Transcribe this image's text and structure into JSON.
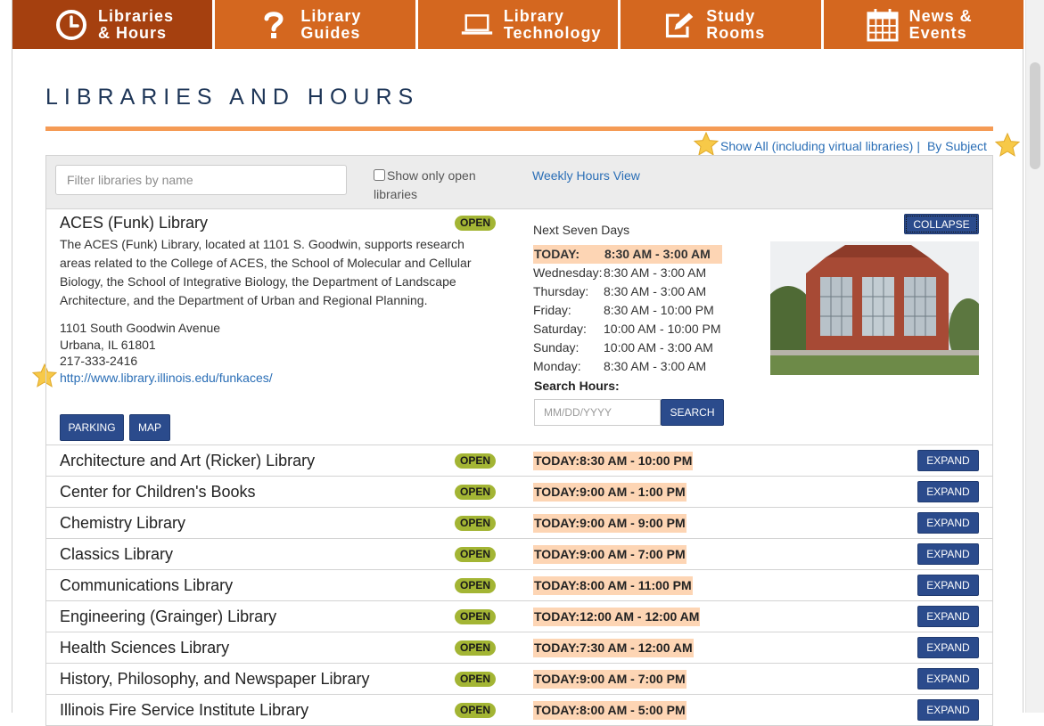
{
  "nav": {
    "tabs": [
      {
        "label": "Libraries\n& Hours",
        "icon": "clock-icon",
        "active": true
      },
      {
        "label": "Library\nGuides",
        "icon": "question-mark-icon",
        "active": false
      },
      {
        "label": "Library\nTechnology",
        "icon": "laptop-icon",
        "active": false
      },
      {
        "label": "Study\nRooms",
        "icon": "pencil-square-icon",
        "active": false
      },
      {
        "label": "News &\nEvents",
        "icon": "calendar-icon",
        "active": false
      }
    ]
  },
  "page": {
    "title": "LIBRARIES AND HOURS"
  },
  "links": {
    "show_all": "Show All (including virtual libraries)",
    "separator": "|",
    "by_subject": "By Subject"
  },
  "filter": {
    "placeholder": "Filter libraries by name",
    "open_only_label": "Show only open libraries",
    "weekly_link": "Weekly Hours View"
  },
  "expanded": {
    "name": "ACES (Funk) Library",
    "status": "OPEN",
    "collapse_label": "COLLAPSE",
    "description": "The ACES (Funk) Library, located at 1101 S. Goodwin, supports research areas related to the College of ACES, the School of Molecular and Cellular Biology, the School of Integrative Biology, the Department of Landscape Architecture, and the Department of Urban and Regional Planning.",
    "address1": "1101 South Goodwin Avenue",
    "address2": "Urbana, IL 61801",
    "phone": "217-333-2416",
    "url": "http://www.library.illinois.edu/funkaces/",
    "parking_label": "PARKING",
    "map_label": "MAP",
    "week_title": "Next Seven Days",
    "hours": [
      {
        "day": "TODAY:",
        "time": "8:30 AM - 3:00 AM"
      },
      {
        "day": "Wednesday:",
        "time": "8:30 AM - 3:00 AM"
      },
      {
        "day": "Thursday:",
        "time": "8:30 AM - 3:00 AM"
      },
      {
        "day": "Friday:",
        "time": "8:30 AM - 10:00 PM"
      },
      {
        "day": "Saturday:",
        "time": "10:00 AM - 10:00 PM"
      },
      {
        "day": "Sunday:",
        "time": "10:00 AM - 3:00 AM"
      },
      {
        "day": "Monday:",
        "time": "8:30 AM - 3:00 AM"
      }
    ],
    "search_label": "Search Hours:",
    "date_placeholder": "MM/DD/YYYY",
    "search_button": "SEARCH"
  },
  "libraries": [
    {
      "name": "Architecture and Art (Ricker) Library",
      "status": "OPEN",
      "today": "TODAY:8:30 AM - 10:00 PM",
      "action": "EXPAND"
    },
    {
      "name": "Center for Children's Books",
      "status": "OPEN",
      "today": "TODAY:9:00 AM - 1:00 PM",
      "action": "EXPAND"
    },
    {
      "name": "Chemistry Library",
      "status": "OPEN",
      "today": "TODAY:9:00 AM - 9:00 PM",
      "action": "EXPAND"
    },
    {
      "name": "Classics Library",
      "status": "OPEN",
      "today": "TODAY:9:00 AM - 7:00 PM",
      "action": "EXPAND"
    },
    {
      "name": "Communications Library",
      "status": "OPEN",
      "today": "TODAY:8:00 AM - 11:00 PM",
      "action": "EXPAND"
    },
    {
      "name": "Engineering (Grainger) Library",
      "status": "OPEN",
      "today": "TODAY:12:00 AM - 12:00 AM",
      "action": "EXPAND"
    },
    {
      "name": "Health Sciences Library",
      "status": "OPEN",
      "today": "TODAY:7:30 AM - 12:00 AM",
      "action": "EXPAND"
    },
    {
      "name": "History, Philosophy, and Newspaper Library",
      "status": "OPEN",
      "today": "TODAY:9:00 AM - 7:00 PM",
      "action": "EXPAND"
    },
    {
      "name": "Illinois Fire Service Institute Library",
      "status": "OPEN",
      "today": "TODAY:8:00 AM - 5:00 PM",
      "action": "EXPAND"
    }
  ],
  "colors": {
    "nav_tab": "#d4671f",
    "nav_tab_active": "#a5400f",
    "accent_rule": "#f59b55",
    "button": "#2b4b8c",
    "open_badge": "#a3b534",
    "today_highlight": "#fdd5b4",
    "link": "#2a6eb6"
  }
}
